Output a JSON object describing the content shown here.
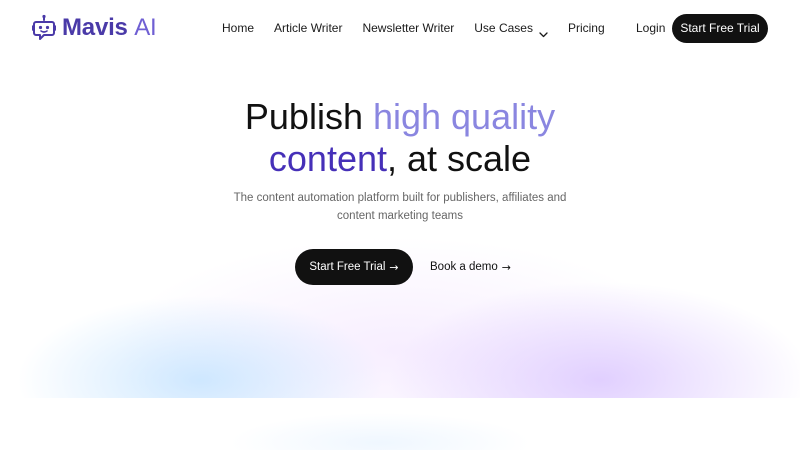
{
  "brand": {
    "name": "Mavis",
    "suffix": "AI",
    "icon": "robot-chat-icon",
    "color": "#4a3aa8"
  },
  "nav": {
    "links": [
      {
        "label": "Home"
      },
      {
        "label": "Article Writer"
      },
      {
        "label": "Newsletter Writer"
      },
      {
        "label": "Use Cases",
        "icon": "chevron-down-icon"
      },
      {
        "label": "Pricing"
      }
    ],
    "login_label": "Login",
    "cta_label": "Start Free Trial"
  },
  "hero": {
    "title_part1": "Publish ",
    "title_highlight1": "high quality",
    "title_highlight2": "content",
    "title_part2": ", at scale",
    "subtitle_line1": "The content automation platform built for publishers, affiliates and",
    "subtitle_line2": "content marketing teams",
    "primary_cta_label": "Start Free Trial",
    "primary_cta_icon": "arrow-right-icon",
    "secondary_cta_label": "Book a demo",
    "secondary_cta_icon": "arrow-right-icon",
    "highlight_color_light": "#8a86e0",
    "highlight_color_dark": "#4630b8"
  }
}
